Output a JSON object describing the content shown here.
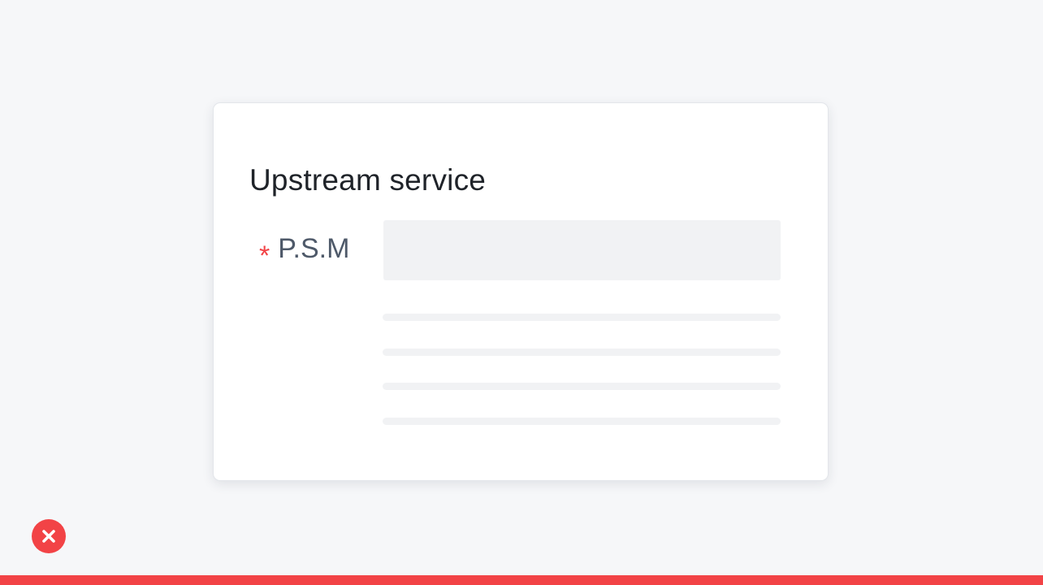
{
  "card": {
    "title": "Upstream service",
    "field": {
      "required_marker": "*",
      "label": "P.S.M",
      "value": "",
      "placeholder": ""
    }
  },
  "icons": {
    "status": "close-icon"
  },
  "colors": {
    "accent": "#f24346",
    "background": "#f6f7f9",
    "card": "#ffffff",
    "input_fill": "#f1f2f4",
    "title": "#1f2329",
    "label": "#4e5969"
  }
}
